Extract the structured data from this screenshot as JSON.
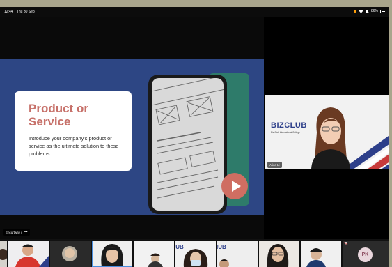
{
  "status_bar": {
    "time": "12:44",
    "date": "Thu 30 Sep",
    "battery_percent": "86%",
    "icons": [
      "orange-dot-icon",
      "wifi-icon",
      "moon-icon",
      "battery-icon"
    ]
  },
  "share": {
    "presenter_label": "Encurtway i",
    "slide": {
      "title": "Product or Service",
      "body": "Introduce your company's product or service as the ultimate solution to these problems."
    }
  },
  "speaker": {
    "name_label": "Alice Li",
    "background_title": "BIZCLUB",
    "background_subtitle": "Biz Club International College"
  },
  "participants": {
    "thumbnails": [
      "video",
      "video",
      "video",
      "video",
      "video",
      "video",
      "video",
      "video",
      "PK"
    ],
    "initials": "PK",
    "selected_index": 2
  },
  "colors": {
    "slide_bg": "#2d4684",
    "title_accent": "#c7716a",
    "play_button": "#cf6e62",
    "phone_accent": "#2e7b6a",
    "bizclub_blue": "#2d3f8a",
    "status_accent": "#ff9f0a"
  }
}
